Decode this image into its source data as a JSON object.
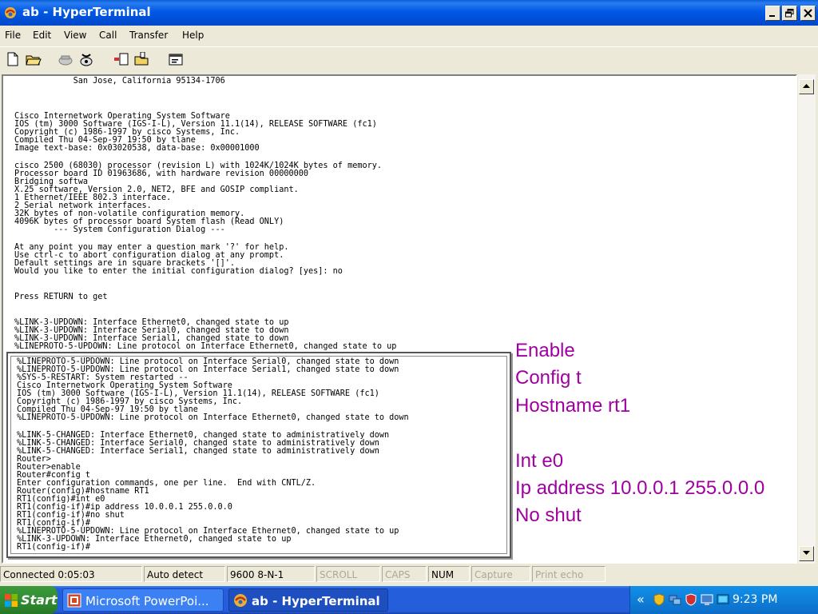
{
  "window": {
    "title": "ab - HyperTerminal"
  },
  "menu": [
    "File",
    "Edit",
    "View",
    "Call",
    "Transfer",
    "Help"
  ],
  "toolbar_icons": [
    "new-icon",
    "open-icon",
    "disconnect-icon",
    "dial-icon",
    "send-icon",
    "receive-icon",
    "properties-icon"
  ],
  "terminal": {
    "lines": [
      "            San Jose, California 95134-1706",
      "",
      "",
      "Cisco Internetwork Operating System Software",
      "IOS (tm) 3000 Software (IGS-I-L), Version 11.1(14), RELEASE SOFTWARE (fc1)",
      "Copyright (c) 1986-1997 by cisco Systems, Inc.",
      "Compiled Thu 04-Sep-97 19:50 by tlane",
      "Image text-base: 0x03020538, data-base: 0x00001000",
      "",
      "cisco 2500 (68030) processor (revision L) with 1024K/1024K bytes of memory.",
      "Processor board ID 01963686, with hardware revision 00000000",
      "Bridging softwa",
      "X.25 software, Version 2.0, NET2, BFE and GOSIP compliant.",
      "1 Ethernet/IEEE 802.3 interface.",
      "2 Serial network interfaces.",
      "32K bytes of non-volatile configuration memory.",
      "4096K bytes of processor board System flash (Read ONLY)",
      "        --- System Configuration Dialog ---",
      "",
      "At any point you may enter a question mark '?' for help.",
      "Use ctrl-c to abort configuration dialog at any prompt.",
      "Default settings are in square brackets '[]'.",
      "Would you like to enter the initial configuration dialog? [yes]: no",
      "",
      "",
      "Press RETURN to get",
      "",
      "",
      "%LINK-3-UPDOWN: Interface Ethernet0, changed state to up",
      "%LINK-3-UPDOWN: Interface Serial0, changed state to down",
      "%LINK-3-UPDOWN: Interface Serial1, changed state to down",
      "%LINEPROTO-5-UPDOWN: Line protocol on Interface Ethernet0, changed state to up"
    ]
  },
  "overlay": {
    "lines": [
      "%LINEPROTO-5-UPDOWN: Line protocol on Interface Serial0, changed state to down",
      "%LINEPROTO-5-UPDOWN: Line protocol on Interface Serial1, changed state to down",
      "%SYS-5-RESTART: System restarted --",
      "Cisco Internetwork Operating System Software",
      "IOS (tm) 3000 Software (IGS-I-L), Version 11.1(14), RELEASE SOFTWARE (fc1)",
      "Copyright (c) 1986-1997 by cisco Systems, Inc.",
      "Compiled Thu 04-Sep-97 19:50 by tlane",
      "%LINEPROTO-5-UPDOWN: Line protocol on Interface Ethernet0, changed state to down",
      "",
      "%LINK-5-CHANGED: Interface Ethernet0, changed state to administratively down",
      "%LINK-5-CHANGED: Interface Serial0, changed state to administratively down",
      "%LINK-5-CHANGED: Interface Serial1, changed state to administratively down",
      "Router>",
      "Router>enable",
      "Router#config t",
      "Enter configuration commands, one per line.  End with CNTL/Z.",
      "Router(config)#hostname RT1",
      "RT1(config)#int e0",
      "RT1(config-if)#ip address 10.0.0.1 255.0.0.0",
      "RT1(config-if)#no shut",
      "RT1(config-if)#",
      "%LINEPROTO-5-UPDOWN: Line protocol on Interface Ethernet0, changed state to up",
      "%LINK-3-UPDOWN: Interface Ethernet0, changed state to up",
      "RT1(config-if)#"
    ]
  },
  "notes": [
    "Enable",
    "Config t",
    "Hostname rt1",
    "",
    "Int e0",
    "Ip address 10.0.0.1 255.0.0.0",
    "No shut"
  ],
  "status": {
    "connected": "Connected 0:05:03",
    "detect": "Auto detect",
    "settings": "9600 8-N-1",
    "scroll": "SCROLL",
    "caps": "CAPS",
    "num": "NUM",
    "capture": "Capture",
    "print": "Print echo"
  },
  "taskbar": {
    "start": "Start",
    "tasks": [
      "Microsoft PowerPoi...",
      "ab - HyperTerminal"
    ],
    "clock": "9:23 PM",
    "tray_chevron": "«"
  },
  "colors": {
    "note_text": "#a000a0",
    "titlebar": "#0058e6",
    "taskbar": "#245edb"
  }
}
